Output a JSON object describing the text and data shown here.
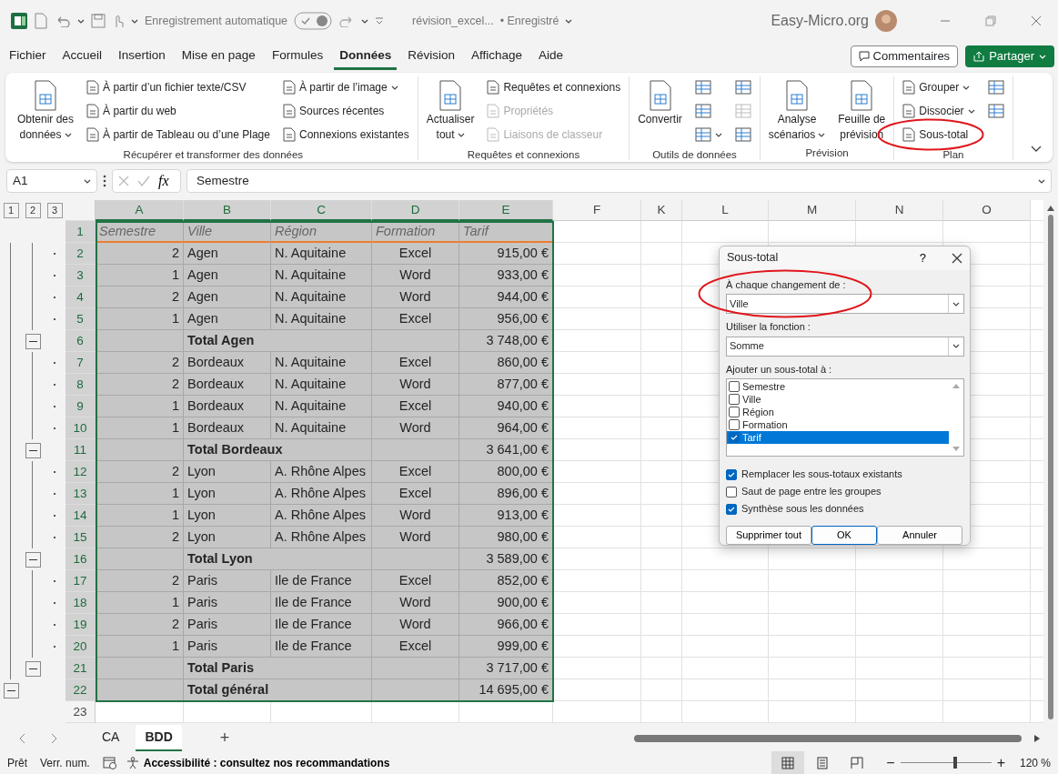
{
  "title_bar": {
    "autosave_label": "Enregistrement automatique",
    "autosave_on": true,
    "file_name": "révision_excel...",
    "save_status": "• Enregistré",
    "site": "Easy-Micro.org"
  },
  "menu_tabs": [
    {
      "label": "Fichier",
      "selected": false
    },
    {
      "label": "Accueil",
      "selected": false
    },
    {
      "label": "Insertion",
      "selected": false
    },
    {
      "label": "Mise en page",
      "selected": false
    },
    {
      "label": "Formules",
      "selected": false
    },
    {
      "label": "Données",
      "selected": true
    },
    {
      "label": "Révision",
      "selected": false
    },
    {
      "label": "Affichage",
      "selected": false
    },
    {
      "label": "Aide",
      "selected": false
    }
  ],
  "comments_button": "Commentaires",
  "share_button": "Partager",
  "ribbon_groups": [
    {
      "label": "Récupérer et transformer des données",
      "columns": [
        [
          {
            "kind": "large",
            "lines": [
              "Obtenir des",
              "données"
            ],
            "dropdown": true,
            "disabled": false
          }
        ],
        [
          {
            "kind": "small",
            "label": "À partir d’un fichier texte/CSV",
            "disabled": false
          },
          {
            "kind": "small",
            "label": "À partir du web",
            "disabled": false
          },
          {
            "kind": "small",
            "label": "À partir de Tableau ou d’une Plage",
            "disabled": false
          }
        ],
        [
          {
            "kind": "small",
            "label": "À partir de l’image",
            "dropdown": true,
            "disabled": false
          },
          {
            "kind": "small",
            "label": "Sources récentes",
            "disabled": false
          },
          {
            "kind": "small",
            "label": "Connexions existantes",
            "disabled": false
          }
        ]
      ]
    },
    {
      "label": "Requêtes et connexions",
      "columns": [
        [
          {
            "kind": "large",
            "lines": [
              "Actualiser",
              "tout"
            ],
            "dropdown": true,
            "disabled": false
          }
        ],
        [
          {
            "kind": "small",
            "label": "Requêtes et connexions",
            "disabled": false
          },
          {
            "kind": "small",
            "label": "Propriétés",
            "disabled": true
          },
          {
            "kind": "small",
            "label": "Liaisons de classeur",
            "disabled": true
          }
        ]
      ]
    },
    {
      "label": "Outils de données",
      "columns": [
        [
          {
            "kind": "large",
            "lines": [
              "Convertir"
            ],
            "disabled": false
          }
        ],
        [
          {
            "kind": "icon",
            "disabled": false
          },
          {
            "kind": "icon",
            "disabled": false
          },
          {
            "kind": "icon",
            "dropdown": true,
            "disabled": false
          }
        ],
        [
          {
            "kind": "icon",
            "disabled": false
          },
          {
            "kind": "icon",
            "disabled": true
          },
          {
            "kind": "icon",
            "disabled": false
          }
        ]
      ]
    },
    {
      "label": "Prévision",
      "columns": [
        [
          {
            "kind": "large",
            "lines": [
              "Analyse",
              "scénarios"
            ],
            "dropdown": true,
            "disabled": false
          }
        ],
        [
          {
            "kind": "large",
            "lines": [
              "Feuille de",
              "prévision"
            ],
            "disabled": false
          }
        ]
      ]
    },
    {
      "label": "Plan",
      "columns": [
        [
          {
            "kind": "small",
            "label": "Grouper",
            "dropdown": true,
            "disabled": false
          },
          {
            "kind": "small",
            "label": "Dissocier",
            "dropdown": true,
            "disabled": false
          },
          {
            "kind": "small",
            "label": "Sous-total",
            "disabled": false
          }
        ],
        [
          {
            "kind": "icon",
            "disabled": false
          },
          {
            "kind": "icon",
            "disabled": false
          }
        ]
      ]
    }
  ],
  "formula_bar": {
    "cell_ref": "A1",
    "function_label": "fx",
    "content": "Semestre"
  },
  "outline_levels": [
    "1",
    "2",
    "3"
  ],
  "columns": [
    {
      "label": "A",
      "selected": true
    },
    {
      "label": "B",
      "selected": true
    },
    {
      "label": "C",
      "selected": true
    },
    {
      "label": "D",
      "selected": true
    },
    {
      "label": "E",
      "selected": true
    },
    {
      "label": "F",
      "selected": false
    },
    {
      "label": "K",
      "selected": false
    },
    {
      "label": "L",
      "selected": false
    },
    {
      "label": "M",
      "selected": false
    },
    {
      "label": "N",
      "selected": false
    },
    {
      "label": "O",
      "selected": false
    }
  ],
  "rows": [
    {
      "header": "1",
      "kind": "header",
      "selected": true,
      "cells": [
        "Semestre",
        "Ville",
        "Région",
        "Formation",
        "Tarif"
      ]
    },
    {
      "header": "2",
      "kind": "detail",
      "selected": true,
      "cells": [
        "2",
        "Agen",
        "N. Aquitaine",
        "Excel",
        "915,00 €"
      ]
    },
    {
      "header": "3",
      "kind": "detail",
      "selected": true,
      "cells": [
        "1",
        "Agen",
        "N. Aquitaine",
        "Word",
        "933,00 €"
      ]
    },
    {
      "header": "4",
      "kind": "detail",
      "selected": true,
      "cells": [
        "2",
        "Agen",
        "N. Aquitaine",
        "Word",
        "944,00 €"
      ]
    },
    {
      "header": "5",
      "kind": "detail",
      "selected": true,
      "cells": [
        "1",
        "Agen",
        "N. Aquitaine",
        "Excel",
        "956,00 €"
      ]
    },
    {
      "header": "6",
      "kind": "total",
      "selected": true,
      "expanded": true,
      "label": "Total Agen",
      "value": "3 748,00 €"
    },
    {
      "header": "7",
      "kind": "detail",
      "selected": true,
      "cells": [
        "2",
        "Bordeaux",
        "N. Aquitaine",
        "Excel",
        "860,00 €"
      ]
    },
    {
      "header": "8",
      "kind": "detail",
      "selected": true,
      "cells": [
        "2",
        "Bordeaux",
        "N. Aquitaine",
        "Word",
        "877,00 €"
      ]
    },
    {
      "header": "9",
      "kind": "detail",
      "selected": true,
      "cells": [
        "1",
        "Bordeaux",
        "N. Aquitaine",
        "Excel",
        "940,00 €"
      ]
    },
    {
      "header": "10",
      "kind": "detail",
      "selected": true,
      "cells": [
        "1",
        "Bordeaux",
        "N. Aquitaine",
        "Word",
        "964,00 €"
      ]
    },
    {
      "header": "11",
      "kind": "total",
      "selected": true,
      "expanded": true,
      "label": "Total Bordeaux",
      "value": "3 641,00 €"
    },
    {
      "header": "12",
      "kind": "detail",
      "selected": true,
      "cells": [
        "2",
        "Lyon",
        "A. Rhône Alpes",
        "Excel",
        "800,00 €"
      ]
    },
    {
      "header": "13",
      "kind": "detail",
      "selected": true,
      "cells": [
        "1",
        "Lyon",
        "A. Rhône Alpes",
        "Excel",
        "896,00 €"
      ]
    },
    {
      "header": "14",
      "kind": "detail",
      "selected": true,
      "cells": [
        "1",
        "Lyon",
        "A. Rhône Alpes",
        "Word",
        "913,00 €"
      ]
    },
    {
      "header": "15",
      "kind": "detail",
      "selected": true,
      "cells": [
        "2",
        "Lyon",
        "A. Rhône Alpes",
        "Word",
        "980,00 €"
      ]
    },
    {
      "header": "16",
      "kind": "total",
      "selected": true,
      "expanded": true,
      "label": "Total Lyon",
      "value": "3 589,00 €"
    },
    {
      "header": "17",
      "kind": "detail",
      "selected": true,
      "cells": [
        "2",
        "Paris",
        "Ile de France",
        "Excel",
        "852,00 €"
      ]
    },
    {
      "header": "18",
      "kind": "detail",
      "selected": true,
      "cells": [
        "1",
        "Paris",
        "Ile de France",
        "Word",
        "900,00 €"
      ]
    },
    {
      "header": "19",
      "kind": "detail",
      "selected": true,
      "cells": [
        "2",
        "Paris",
        "Ile de France",
        "Word",
        "966,00 €"
      ]
    },
    {
      "header": "20",
      "kind": "detail",
      "selected": true,
      "cells": [
        "1",
        "Paris",
        "Ile de France",
        "Excel",
        "999,00 €"
      ]
    },
    {
      "header": "21",
      "kind": "total",
      "selected": true,
      "expanded": true,
      "label": "Total Paris",
      "value": "3 717,00 €"
    },
    {
      "header": "22",
      "kind": "grand",
      "selected": true,
      "expanded": true,
      "label": "Total général",
      "value": "14 695,00 €"
    },
    {
      "header": "23",
      "kind": "empty",
      "selected": false
    }
  ],
  "dialog": {
    "title": "Sous-total",
    "help": "?",
    "fields": [
      {
        "label": "À chaque changement de :",
        "value": "Ville"
      },
      {
        "label": "Utiliser la fonction :",
        "value": "Somme"
      }
    ],
    "list_label": "Ajouter un sous-total à :",
    "list_items": [
      {
        "label": "Semestre",
        "checked": false,
        "selected": false
      },
      {
        "label": "Ville",
        "checked": false,
        "selected": false
      },
      {
        "label": "Région",
        "checked": false,
        "selected": false
      },
      {
        "label": "Formation",
        "checked": false,
        "selected": false
      },
      {
        "label": "Tarif",
        "checked": true,
        "selected": true
      }
    ],
    "options": [
      {
        "label": "Remplacer les sous-totaux existants",
        "checked": true
      },
      {
        "label": "Saut de page entre les groupes",
        "checked": false
      },
      {
        "label": "Synthèse sous les données",
        "checked": true
      }
    ],
    "buttons": [
      {
        "label": "Supprimer tout",
        "default": false
      },
      {
        "label": "OK",
        "default": true
      },
      {
        "label": "Annuler",
        "default": false
      }
    ]
  },
  "sheet_tabs": [
    {
      "label": "CA",
      "selected": false
    },
    {
      "label": "BDD",
      "selected": true
    }
  ],
  "add_sheet": "+",
  "status_bar": {
    "ready": "Prêt",
    "num_lock": "Verr. num.",
    "accessibility": "Accessibilité : consultez nos recommandations",
    "views": [
      {
        "kind": "normal",
        "selected": true
      },
      {
        "kind": "page_layout",
        "selected": false
      },
      {
        "kind": "page_break",
        "selected": false
      }
    ],
    "zoom": {
      "minus": "−",
      "plus": "+",
      "level": 0.6,
      "reading": "120 %"
    }
  }
}
